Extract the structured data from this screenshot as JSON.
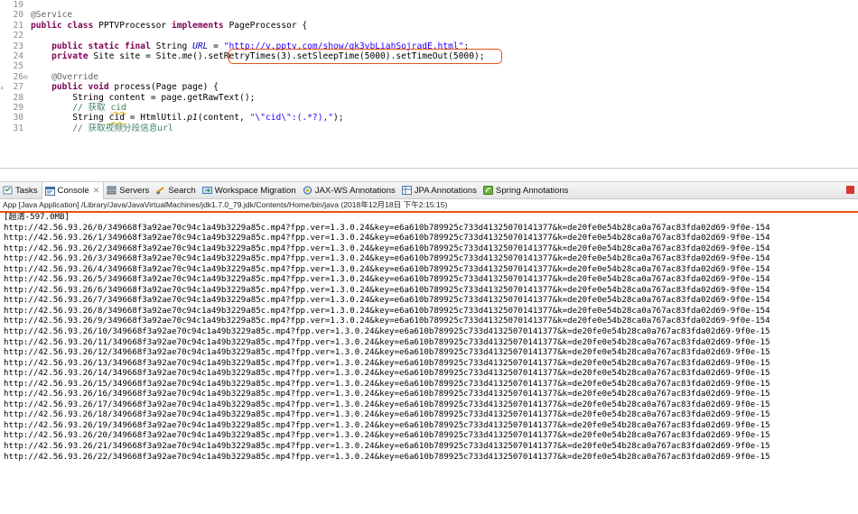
{
  "editor": {
    "lines": [
      {
        "num": "19",
        "tokens": []
      },
      {
        "num": "20",
        "tokens": [
          {
            "t": "@Service",
            "c": "ann"
          }
        ]
      },
      {
        "num": "21",
        "tokens": [
          {
            "t": "public class",
            "c": "kw"
          },
          {
            "t": " PPTVProcessor "
          },
          {
            "t": "implements",
            "c": "kw"
          },
          {
            "t": " PageProcessor {"
          }
        ]
      },
      {
        "num": "22",
        "tokens": []
      },
      {
        "num": "23",
        "tokens": [
          {
            "t": "    "
          },
          {
            "t": "public static final",
            "c": "kw"
          },
          {
            "t": " String "
          },
          {
            "t": "URL",
            "c": "fld"
          },
          {
            "t": " = "
          },
          {
            "t": "\"http://v.pptv.com/show/qk3vbLiahSojradE.html\"",
            "c": "str"
          },
          {
            "t": ";"
          }
        ]
      },
      {
        "num": "24",
        "tokens": [
          {
            "t": "    "
          },
          {
            "t": "private",
            "c": "kw"
          },
          {
            "t": " Site site = Site."
          },
          {
            "t": "me",
            "c": "stat"
          },
          {
            "t": "().setRetryTimes(3).setSleepTime(5000).setTimeOut(5000);"
          }
        ]
      },
      {
        "num": "25",
        "tokens": []
      },
      {
        "num": "26",
        "mark": "⊖",
        "tokens": [
          {
            "t": "    @Override",
            "c": "ann"
          }
        ]
      },
      {
        "num": "27",
        "arrow": "▵",
        "tokens": [
          {
            "t": "    "
          },
          {
            "t": "public void",
            "c": "kw"
          },
          {
            "t": " process(Page page) {"
          }
        ]
      },
      {
        "num": "28",
        "tokens": [
          {
            "t": "        String content = page.getRawText();"
          }
        ]
      },
      {
        "num": "29",
        "tokens": [
          {
            "t": "        // 获取 ",
            "c": "cmt"
          },
          {
            "t": "cid",
            "c": "cmt squig"
          }
        ]
      },
      {
        "num": "30",
        "tokens": [
          {
            "t": "        String "
          },
          {
            "t": "cid",
            "c": "squig"
          },
          {
            "t": " = HtmlUtil."
          },
          {
            "t": "p1",
            "c": "stat"
          },
          {
            "t": "(content, "
          },
          {
            "t": "\"\\\"cid\\\":(.*?),\"",
            "c": "str"
          },
          {
            "t": ");"
          }
        ]
      },
      {
        "num": "31",
        "tokens": [
          {
            "t": "        // 获取视频分段信息url",
            "c": "cmt"
          }
        ]
      }
    ]
  },
  "tabs": [
    {
      "label": "Tasks",
      "icon": "tasks-icon",
      "active": false
    },
    {
      "label": "Console",
      "icon": "console-icon",
      "active": true,
      "close": "✕"
    },
    {
      "label": "Servers",
      "icon": "servers-icon",
      "active": false
    },
    {
      "label": "Search",
      "icon": "search-icon",
      "active": false
    },
    {
      "label": "Workspace Migration",
      "icon": "workspace-migration-icon",
      "active": false
    },
    {
      "label": "JAX-WS Annotations",
      "icon": "jaxws-icon",
      "active": false
    },
    {
      "label": "JPA Annotations",
      "icon": "jpa-icon",
      "active": false
    },
    {
      "label": "Spring Annotations",
      "icon": "spring-icon",
      "active": false
    }
  ],
  "console": {
    "status": "App [Java Application] /Library/Java/JavaVirtualMachines/jdk1.7.0_79.jdk/Contents/Home/bin/java (2018年12月18日 下午2:15:15)",
    "lines": [
      "[超清-597.0MB]",
      "http://42.56.93.26/0/349668f3a92ae70c94c1a49b3229a85c.mp4?fpp.ver=1.3.0.24&key=e6a610b789925c733d41325070141377&k=de20fe0e54b28ca0a767ac83fda02d69-9f0e-154",
      "http://42.56.93.26/1/349668f3a92ae70c94c1a49b3229a85c.mp4?fpp.ver=1.3.0.24&key=e6a610b789925c733d41325070141377&k=de20fe0e54b28ca0a767ac83fda02d69-9f0e-154",
      "http://42.56.93.26/2/349668f3a92ae70c94c1a49b3229a85c.mp4?fpp.ver=1.3.0.24&key=e6a610b789925c733d41325070141377&k=de20fe0e54b28ca0a767ac83fda02d69-9f0e-154",
      "http://42.56.93.26/3/349668f3a92ae70c94c1a49b3229a85c.mp4?fpp.ver=1.3.0.24&key=e6a610b789925c733d41325070141377&k=de20fe0e54b28ca0a767ac83fda02d69-9f0e-154",
      "http://42.56.93.26/4/349668f3a92ae70c94c1a49b3229a85c.mp4?fpp.ver=1.3.0.24&key=e6a610b789925c733d41325070141377&k=de20fe0e54b28ca0a767ac83fda02d69-9f0e-154",
      "http://42.56.93.26/5/349668f3a92ae70c94c1a49b3229a85c.mp4?fpp.ver=1.3.0.24&key=e6a610b789925c733d41325070141377&k=de20fe0e54b28ca0a767ac83fda02d69-9f0e-154",
      "http://42.56.93.26/6/349668f3a92ae70c94c1a49b3229a85c.mp4?fpp.ver=1.3.0.24&key=e6a610b789925c733d41325070141377&k=de20fe0e54b28ca0a767ac83fda02d69-9f0e-154",
      "http://42.56.93.26/7/349668f3a92ae70c94c1a49b3229a85c.mp4?fpp.ver=1.3.0.24&key=e6a610b789925c733d41325070141377&k=de20fe0e54b28ca0a767ac83fda02d69-9f0e-154",
      "http://42.56.93.26/8/349668f3a92ae70c94c1a49b3229a85c.mp4?fpp.ver=1.3.0.24&key=e6a610b789925c733d41325070141377&k=de20fe0e54b28ca0a767ac83fda02d69-9f0e-154",
      "http://42.56.93.26/9/349668f3a92ae70c94c1a49b3229a85c.mp4?fpp.ver=1.3.0.24&key=e6a610b789925c733d41325070141377&k=de20fe0e54b28ca0a767ac83fda02d69-9f0e-154",
      "http://42.56.93.26/10/349668f3a92ae70c94c1a49b3229a85c.mp4?fpp.ver=1.3.0.24&key=e6a610b789925c733d41325070141377&k=de20fe0e54b28ca0a767ac83fda02d69-9f0e-15",
      "http://42.56.93.26/11/349668f3a92ae70c94c1a49b3229a85c.mp4?fpp.ver=1.3.0.24&key=e6a610b789925c733d41325070141377&k=de20fe0e54b28ca0a767ac83fda02d69-9f0e-15",
      "http://42.56.93.26/12/349668f3a92ae70c94c1a49b3229a85c.mp4?fpp.ver=1.3.0.24&key=e6a610b789925c733d41325070141377&k=de20fe0e54b28ca0a767ac83fda02d69-9f0e-15",
      "http://42.56.93.26/13/349668f3a92ae70c94c1a49b3229a85c.mp4?fpp.ver=1.3.0.24&key=e6a610b789925c733d41325070141377&k=de20fe0e54b28ca0a767ac83fda02d69-9f0e-15",
      "http://42.56.93.26/14/349668f3a92ae70c94c1a49b3229a85c.mp4?fpp.ver=1.3.0.24&key=e6a610b789925c733d41325070141377&k=de20fe0e54b28ca0a767ac83fda02d69-9f0e-15",
      "http://42.56.93.26/15/349668f3a92ae70c94c1a49b3229a85c.mp4?fpp.ver=1.3.0.24&key=e6a610b789925c733d41325070141377&k=de20fe0e54b28ca0a767ac83fda02d69-9f0e-15",
      "http://42.56.93.26/16/349668f3a92ae70c94c1a49b3229a85c.mp4?fpp.ver=1.3.0.24&key=e6a610b789925c733d41325070141377&k=de20fe0e54b28ca0a767ac83fda02d69-9f0e-15",
      "http://42.56.93.26/17/349668f3a92ae70c94c1a49b3229a85c.mp4?fpp.ver=1.3.0.24&key=e6a610b789925c733d41325070141377&k=de20fe0e54b28ca0a767ac83fda02d69-9f0e-15",
      "http://42.56.93.26/18/349668f3a92ae70c94c1a49b3229a85c.mp4?fpp.ver=1.3.0.24&key=e6a610b789925c733d41325070141377&k=de20fe0e54b28ca0a767ac83fda02d69-9f0e-15",
      "http://42.56.93.26/19/349668f3a92ae70c94c1a49b3229a85c.mp4?fpp.ver=1.3.0.24&key=e6a610b789925c733d41325070141377&k=de20fe0e54b28ca0a767ac83fda02d69-9f0e-15",
      "http://42.56.93.26/20/349668f3a92ae70c94c1a49b3229a85c.mp4?fpp.ver=1.3.0.24&key=e6a610b789925c733d41325070141377&k=de20fe0e54b28ca0a767ac83fda02d69-9f0e-15",
      "http://42.56.93.26/21/349668f3a92ae70c94c1a49b3229a85c.mp4?fpp.ver=1.3.0.24&key=e6a610b789925c733d41325070141377&k=de20fe0e54b28ca0a767ac83fda02d69-9f0e-15",
      "http://42.56.93.26/22/349668f3a92ae70c94c1a49b3229a85c.mp4?fpp.ver=1.3.0.24&key=e6a610b789925c733d41325070141377&k=de20fe0e54b28ca0a767ac83fda02d69-9f0e-15"
    ]
  },
  "colors": {
    "highlight": "#e8530f",
    "stop": "#d9362b"
  }
}
